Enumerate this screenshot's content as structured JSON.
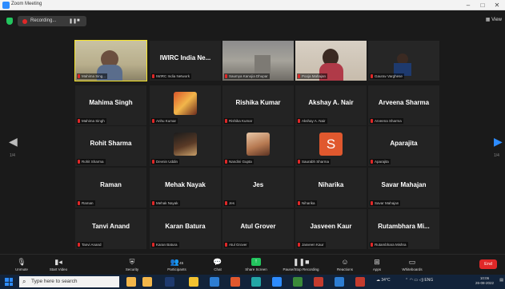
{
  "window": {
    "title": "Zoom Meeting"
  },
  "header": {
    "recording_label": "Recording...",
    "pause_icon": "pause-icon",
    "stop_icon": "stop-icon",
    "view_label": "View"
  },
  "grid": {
    "tiles": [
      {
        "center_name": "",
        "label": "Mahima Sing..."
      },
      {
        "center_name": "IWIRC India Ne...",
        "label": "IWIRC India Network"
      },
      {
        "center_name": "",
        "label": "Saumya Kanojia Dhupar"
      },
      {
        "center_name": "",
        "label": "Pooja Mahajan"
      },
      {
        "center_name": "",
        "label": "Gaurav Varghese"
      },
      {
        "center_name": "Mahima Singh",
        "label": "Mahima Singh"
      },
      {
        "center_name": "",
        "label": "Anhu Kumar"
      },
      {
        "center_name": "Rishika Kumar",
        "label": "Rishika Kumar"
      },
      {
        "center_name": "Akshay A. Nair",
        "label": "Akshay A. Nair"
      },
      {
        "center_name": "Arveena Sharma",
        "label": "Arveena Sharma"
      },
      {
        "center_name": "Rohit Sharma",
        "label": "Rohit Sharma"
      },
      {
        "center_name": "",
        "label": "Devnin Uddin"
      },
      {
        "center_name": "",
        "label": "Nandini Gupta"
      },
      {
        "center_name": "",
        "label": "Saurabh Sharma"
      },
      {
        "center_name": "Aparajita",
        "label": "Aparajita"
      },
      {
        "center_name": "Raman",
        "label": "Raman"
      },
      {
        "center_name": "Mehak Nayak",
        "label": "Mehak Nayak"
      },
      {
        "center_name": "Jes",
        "label": "Jes"
      },
      {
        "center_name": "Niharika",
        "label": "Niharika"
      },
      {
        "center_name": "Savar Mahajan",
        "label": "Savar Mahajan"
      },
      {
        "center_name": "Tanvi Anand",
        "label": "Tanvi Anand"
      },
      {
        "center_name": "Karan Batura",
        "label": "Karan Batura"
      },
      {
        "center_name": "Atul Grover",
        "label": "Atul Grover"
      },
      {
        "center_name": "Jasveen Kaur",
        "label": "Jasveen Kaur"
      },
      {
        "center_name": "Rutambhara Mi...",
        "label": "Rutambhara Mishra"
      }
    ],
    "avatar_letter": "S",
    "page_left": "1/4",
    "page_right": "1/4"
  },
  "toolbar": {
    "unmute": "Unmute",
    "start_video": "Start Video",
    "security": "Security",
    "participants": "Participants",
    "participants_count": "45",
    "chat": "Chat",
    "share_screen": "Share Screen",
    "pause_recording": "Pause/Stop Recording",
    "reactions": "Reactions",
    "apps": "Apps",
    "whiteboards": "Whiteboards",
    "end": "End"
  },
  "taskbar": {
    "search_placeholder": "Type here to search",
    "weather": "34°C",
    "lang": "ENG",
    "time": "10:06",
    "date": "26-08-2022"
  },
  "colors": {
    "active_speaker": "#f5e42a",
    "share_green": "#23c55e",
    "end_red": "#e02828",
    "avatar_orange": "#e0582e"
  }
}
